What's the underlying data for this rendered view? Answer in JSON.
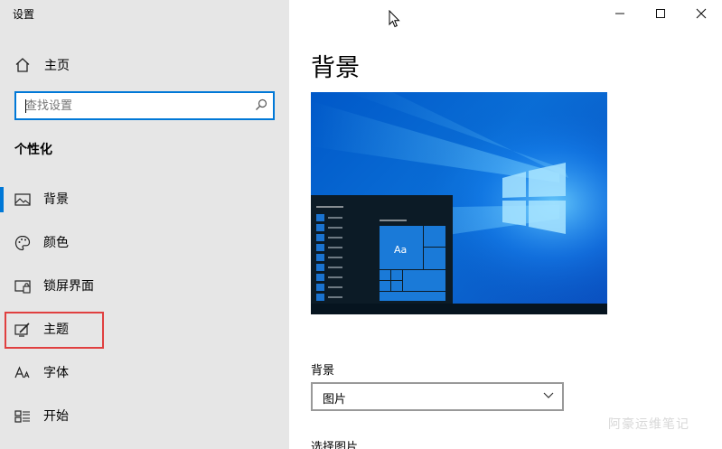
{
  "window": {
    "title": "设置",
    "minimize_icon": "minimize-icon",
    "maximize_icon": "maximize-icon",
    "close_icon": "close-icon"
  },
  "sidebar": {
    "home_label": "主页",
    "search_placeholder": "查找设置",
    "section_title": "个性化",
    "items": [
      {
        "label": "背景",
        "icon": "picture-icon",
        "selected": true
      },
      {
        "label": "颜色",
        "icon": "palette-icon",
        "selected": false
      },
      {
        "label": "锁屏界面",
        "icon": "lock-screen-icon",
        "selected": false
      },
      {
        "label": "主题",
        "icon": "theme-brush-icon",
        "selected": false,
        "highlighted": true
      },
      {
        "label": "字体",
        "icon": "font-icon",
        "selected": false
      },
      {
        "label": "开始",
        "icon": "start-icon",
        "selected": false
      }
    ]
  },
  "main": {
    "heading": "背景",
    "preview": {
      "tile_label": "Aa"
    },
    "background_label": "背景",
    "background_value": "图片",
    "choose_picture_label": "选择图片"
  },
  "watermark": "阿豪运维笔记",
  "colors": {
    "accent": "#0078d7",
    "highlight": "#e04040",
    "sidebar_bg": "#e6e6e6"
  }
}
